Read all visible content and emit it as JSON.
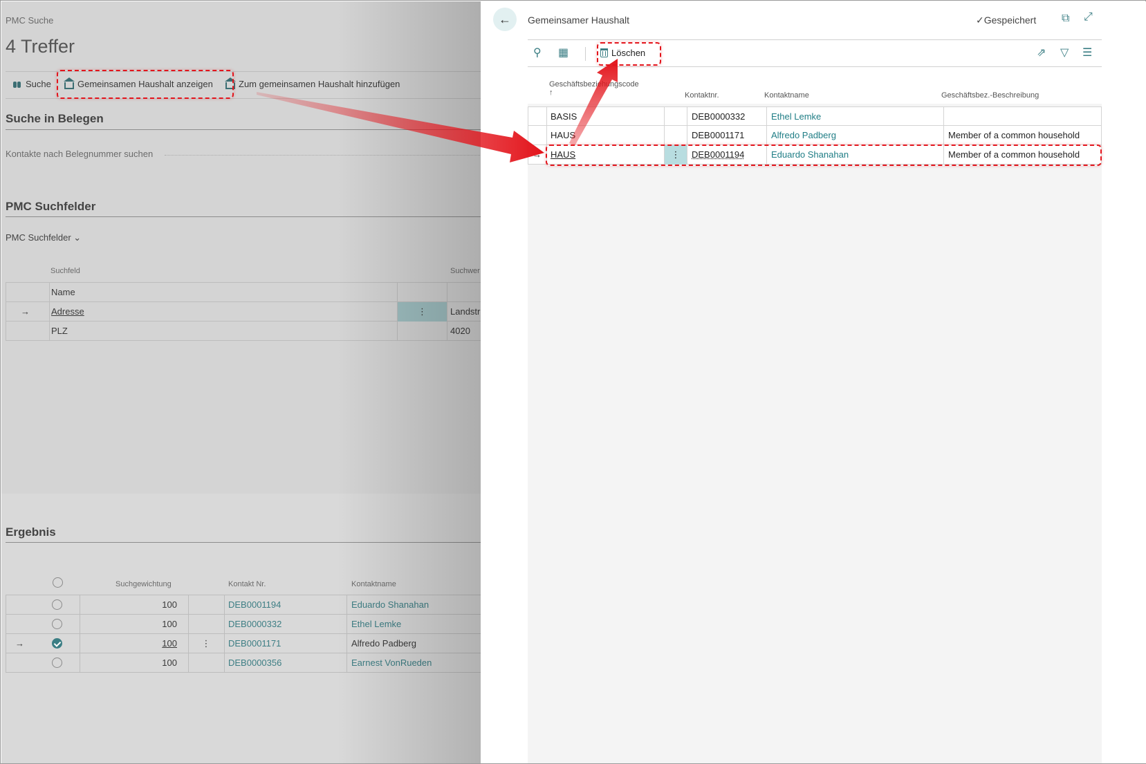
{
  "background": {
    "caption": "PMC Suche",
    "title": "4 Treffer",
    "actions": {
      "search": "Suche",
      "show_household": "Gemeinsamen Haushalt anzeigen",
      "add_household": "Zum gemeinsamen Haushalt hinzufügen"
    },
    "documents_section": {
      "title": "Suche in Belegen",
      "field_label": "Kontakte nach Belegnummer suchen"
    },
    "search_fields_section": {
      "title": "PMC Suchfelder",
      "dropdown_label": "PMC Suchfelder",
      "columns": {
        "field": "Suchfeld",
        "value": "Suchwer"
      },
      "rows": [
        {
          "field": "Name",
          "value": ""
        },
        {
          "field": "Adresse",
          "value": "Landstr"
        },
        {
          "field": "PLZ",
          "value": "4020"
        }
      ]
    },
    "result_section": {
      "title": "Ergebnis",
      "columns": {
        "weight": "Suchgewichtung",
        "contact_no": "Kontakt Nr.",
        "contact_name": "Kontaktname"
      },
      "rows": [
        {
          "weight": "100",
          "contact_no": "DEB0001194",
          "contact_name": "Eduardo Shanahan",
          "checked": false
        },
        {
          "weight": "100",
          "contact_no": "DEB0000332",
          "contact_name": "Ethel Lemke",
          "checked": false
        },
        {
          "weight": "100",
          "contact_no": "DEB0001171",
          "contact_name": "Alfredo Padberg",
          "checked": true
        },
        {
          "weight": "100",
          "contact_no": "DEB0000356",
          "contact_name": "Earnest VonRueden",
          "checked": false
        }
      ]
    }
  },
  "dialog": {
    "caption": "Gemeinsamer Haushalt",
    "saved_label": "Gespeichert",
    "toolbar": {
      "delete_label": "Löschen"
    },
    "columns": {
      "relation_code": "Geschäftsbeziehungscode",
      "sort_indicator": "↑",
      "contact_no": "Kontaktnr.",
      "contact_name": "Kontaktname",
      "description": "Geschäftsbez.-Beschreibung"
    },
    "rows": [
      {
        "code": "BASIS",
        "contact_no": "DEB0000332",
        "contact_name": "Ethel Lemke",
        "description": ""
      },
      {
        "code": "HAUS",
        "contact_no": "DEB0001171",
        "contact_name": "Alfredo Padberg",
        "description": "Member of a common household"
      },
      {
        "code": "HAUS",
        "contact_no": "DEB0001194",
        "contact_name": "Eduardo Shanahan",
        "description": "Member of a common household"
      }
    ]
  },
  "colors": {
    "accent": "#1f7d85",
    "annotation": "#e3141b",
    "selection": "#b8dde0"
  }
}
